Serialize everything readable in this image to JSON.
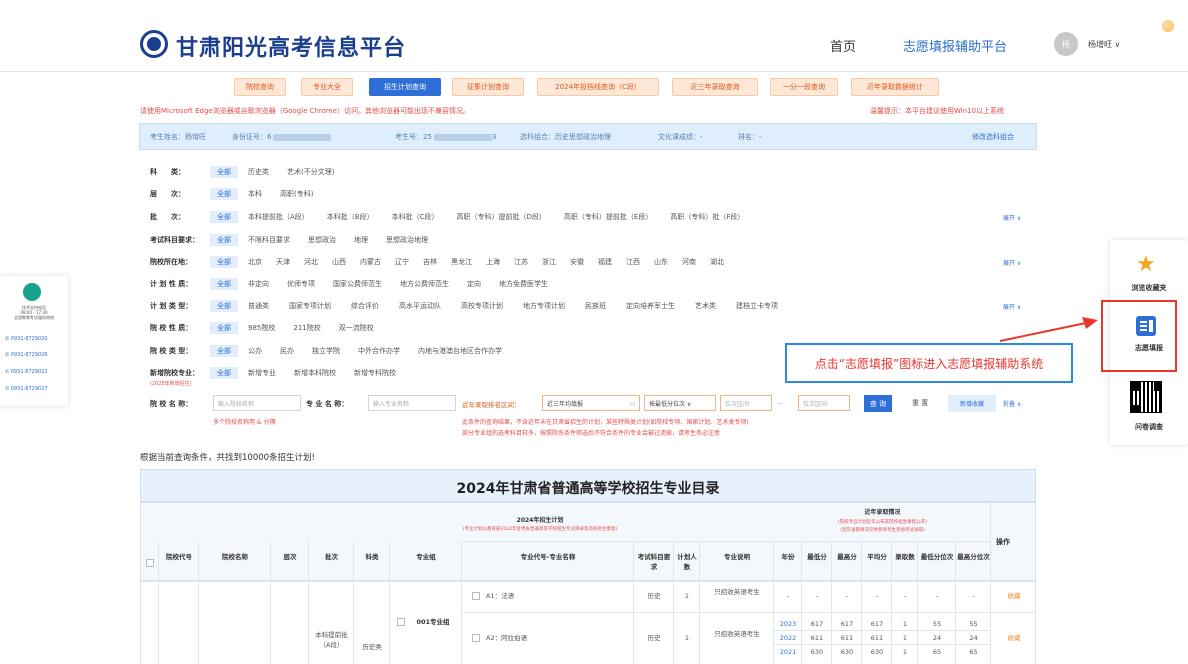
{
  "header": {
    "site_title": "甘肃阳光高考信息平台",
    "nav_home": "首页",
    "nav_assist": "志愿填报辅助平台",
    "avatar_text": "杨",
    "username": "杨增旺 ∨"
  },
  "tabs": [
    "院校查询",
    "专业大全",
    "招生计划查询",
    "征集计划查询",
    "2024年投档线查询（C段）",
    "近三年录取查询",
    "一分一段查询",
    "近年录取数据统计"
  ],
  "warnings": {
    "browser": "请使用Microsoft Edge浏览器或谷歌浏览器（Google Chrome）访问，其他浏览器可能出现不兼容情况。",
    "windows": "温馨提示：本平台建议使用Win10以上系统"
  },
  "infobar": {
    "name": "考生姓名：杨增旺",
    "id_prefix": "身份证号：6",
    "exam_prefix": "考生号：25",
    "exam_suffix": "3",
    "subjects": "选科组合：历史思想政治地理",
    "score": "文化课成绩：-",
    "rank": "排名：-",
    "edit_link": "修改选科组合"
  },
  "filters": [
    {
      "label": "科　　类：",
      "all": "全部",
      "options": [
        "历史类",
        "艺术(不分文理)"
      ]
    },
    {
      "label": "层　　次：",
      "all": "全部",
      "options": [
        "本科",
        "高职(专科)"
      ]
    },
    {
      "label": "批　　次：",
      "all": "全部",
      "options": [
        "本科提前批（A段）",
        "本科批（B段）",
        "本科批（C段）",
        "高职（专科）提前批（D段）",
        "高职（专科）提前批（E段）",
        "高职（专科）批（F段）"
      ],
      "expand": "展开 ∨"
    },
    {
      "label": "考试科目要求：",
      "all": "全部",
      "options": [
        "不限科目要求",
        "思想政治",
        "地理",
        "思想政治地理"
      ]
    },
    {
      "label": "院校所在地：",
      "all": "全部",
      "options": [
        "北京",
        "天津",
        "河北",
        "山西",
        "内蒙古",
        "辽宁",
        "吉林",
        "黑龙江",
        "上海",
        "江苏",
        "浙江",
        "安徽",
        "福建",
        "江西",
        "山东",
        "河南",
        "湖北"
      ],
      "expand": "展开 ∨"
    },
    {
      "label": "计 划 性 质：",
      "all": "全部",
      "options": [
        "非定向",
        "优师专项",
        "国家公费师范生",
        "地方公费师范生",
        "定向",
        "地方免费医学生"
      ]
    },
    {
      "label": "计 划 类 型：",
      "all": "全部",
      "options": [
        "普通类",
        "国家专项计划",
        "综合评价",
        "高水平运动队",
        "高校专项计划",
        "地方专项计划",
        "民族班",
        "定向培养军士生",
        "艺术类",
        "建档立卡专项"
      ],
      "expand": "展开 ∨"
    },
    {
      "label": "院 校 性 质：",
      "all": "全部",
      "options": [
        "985院校",
        "211院校",
        "双一流院校"
      ]
    },
    {
      "label": "院 校 类 型：",
      "all": "全部",
      "options": [
        "公办",
        "民办",
        "独立学院",
        "中外合作办学",
        "内地与港澳台地区合作办学"
      ]
    },
    {
      "label": "新增院校专业：",
      "all": "全部",
      "options": [
        "新增专业",
        "新增本科院校",
        "新增专科院校"
      ]
    }
  ],
  "new_sub": "(2025年新增招生)",
  "search": {
    "school_label": "院 校 名 称：",
    "school_placeholder": "输入院校名称",
    "school_hint": "多个院校名称用 & 分隔",
    "major_label": "专 业 名 称：",
    "major_placeholder": "输入专业名称",
    "range_label": "近年录取排名区间：",
    "avg_value": "近三年均填报",
    "sort_value": "按最低分位次 ∨",
    "rank_min_placeholder": "位次区间",
    "rank_sep": "—",
    "rank_max_placeholder": "位次区间",
    "search_btn": "查 询",
    "clear_btn": "重 置",
    "export_btn": "新增收藏",
    "collapse": "折叠 ∧",
    "hint1": "此条件的查询结果，不含近年未在甘肃省招生的计划，某些特殊类计划(如院校专项、国家计划、艺术类专项)",
    "hint2": "部分专业组的选考科目较多，按照院系条件筛选后不符合条件的专业会被过滤掉，请考生务必注意"
  },
  "result_count": "根据当前查询条件，共找到10000条招生计划!",
  "table": {
    "title": "2024年甘肃省普通高等学校招生专业目录",
    "plan_title": "2024年招生计划",
    "plan_sub": "(专业计划以教育部2024年甘肃省普通高等学校招生专业目录及高校招生章程)",
    "hist_title": "近年录取情况",
    "hist_sub1": "(院校专业计划近年公布其院校招生章程公开)",
    "hist_sub2": "(近年录取情况仅供参考考生参加考试录取)",
    "op_header": "操作",
    "headers": [
      "院校代号",
      "院校名称",
      "层次",
      "批次",
      "科类",
      "专业组",
      "专业代号-专业名称",
      "考试科目要求",
      "计划人数",
      "专业说明",
      "年份",
      "最低分",
      "最高分",
      "平均分",
      "录取数",
      "最低分位次",
      "最高分位次"
    ],
    "group_batch": "本科提前批（A段）",
    "group_type": "历史类",
    "group_name": "001专业组",
    "rows": [
      {
        "major": "A1：法语",
        "req": "历史",
        "plan": "1",
        "note": "只招收英语考生",
        "years": [
          {
            "year": "-",
            "min": "-",
            "max": "-",
            "avg": "-",
            "cnt": "-",
            "minr": "-",
            "maxr": "-"
          }
        ],
        "op": "收藏"
      },
      {
        "major": "A2：阿拉伯语",
        "req": "历史",
        "plan": "1",
        "note": "只招收英语考生",
        "years": [
          {
            "year": "2023",
            "min": "617",
            "max": "617",
            "avg": "617",
            "cnt": "1",
            "minr": "55",
            "maxr": "55"
          },
          {
            "year": "2022",
            "min": "611",
            "max": "611",
            "avg": "611",
            "cnt": "1",
            "minr": "24",
            "maxr": "24"
          },
          {
            "year": "2021",
            "min": "630",
            "max": "630",
            "avg": "630",
            "cnt": "1",
            "minr": "65",
            "maxr": "65"
          }
        ],
        "op": "收藏"
      }
    ]
  },
  "left_card": {
    "title": "技术支持电话\n08:00 - 17:30\n全国教育考试服务热线",
    "phones": [
      "0931-8729020",
      "0931-8729026",
      "0931-8729022",
      "0931-8729027"
    ]
  },
  "right_panel": {
    "browse": "浏览收藏夹",
    "fill": "志愿填报",
    "survey": "问卷调查"
  },
  "callout": "点击“志愿填报”图标进入志愿填报辅助系统"
}
